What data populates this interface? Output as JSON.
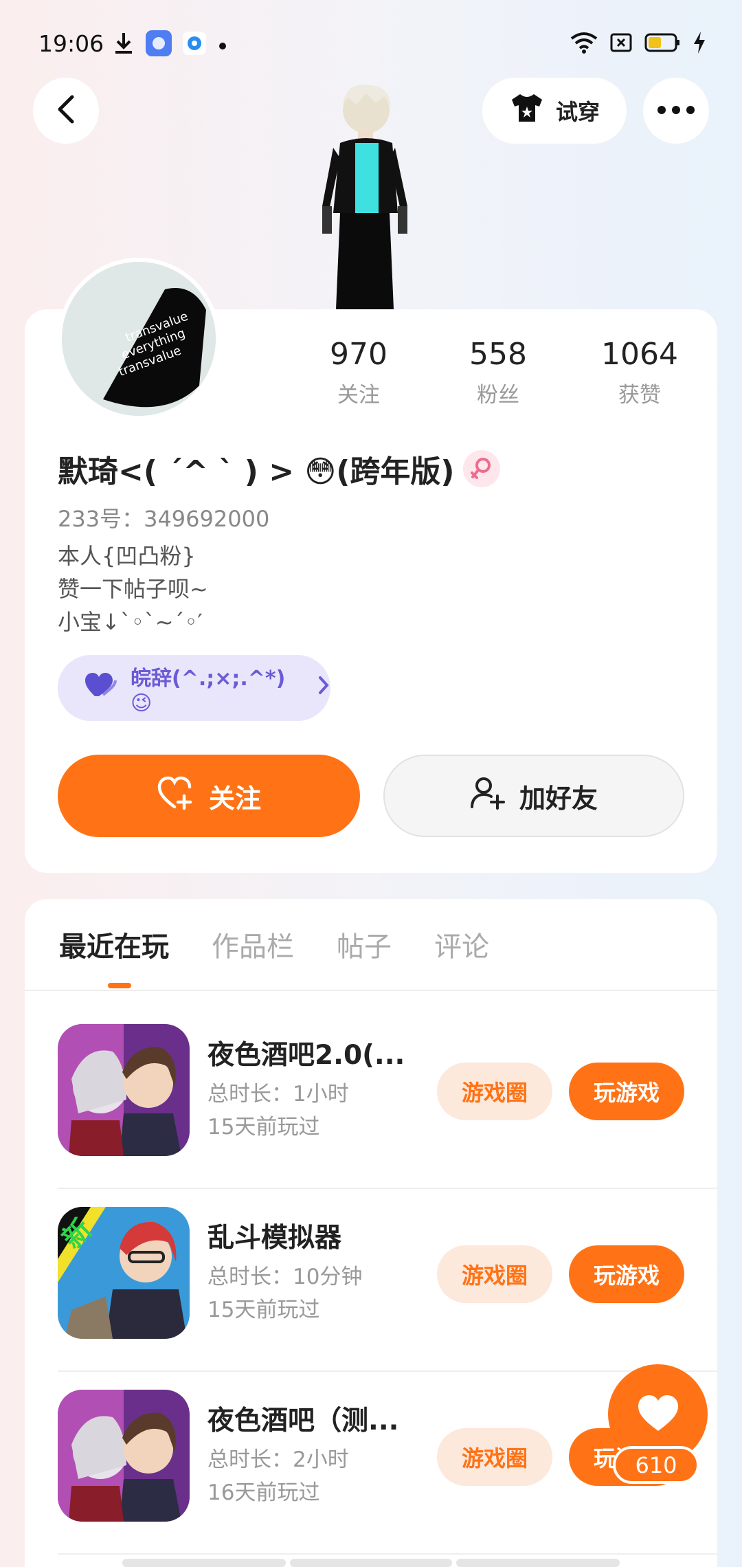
{
  "status_bar": {
    "time": "19:06",
    "icons": [
      "download-icon",
      "app-notification-icon",
      "app-notification-icon",
      "dot-icon",
      "wifi-icon",
      "sim-icon",
      "battery-icon",
      "charging-icon"
    ]
  },
  "header": {
    "try_on_label": "试穿"
  },
  "profile": {
    "stats": [
      {
        "value": "970",
        "label": "关注"
      },
      {
        "value": "558",
        "label": "粉丝"
      },
      {
        "value": "1064",
        "label": "获赞"
      }
    ],
    "nickname": "默琦<( ´^ ` ) > 😳(跨年版)",
    "uid": "233号：349692000",
    "bio_lines": [
      "本人{凹凸粉}",
      "赞一下帖子呗~",
      "小宝↓`◦`~´◦′"
    ],
    "tag_label": "皖辞(^.;×;.^*)😉",
    "follow_label": "关注",
    "add_friend_label": "加好友"
  },
  "tabs": [
    {
      "label": "最近在玩",
      "active": true
    },
    {
      "label": "作品栏",
      "active": false
    },
    {
      "label": "帖子",
      "active": false
    },
    {
      "label": "评论",
      "active": false
    }
  ],
  "games": [
    {
      "title": "夜色酒吧2.0(...",
      "duration": "总时长：1小时",
      "last_played": "15天前玩过",
      "circle_label": "游戏圈",
      "play_label": "玩游戏"
    },
    {
      "title": "乱斗模拟器",
      "duration": "总时长：10分钟",
      "last_played": "15天前玩过",
      "circle_label": "游戏圈",
      "play_label": "玩游戏",
      "badge": "新"
    },
    {
      "title": "夜色酒吧（测...",
      "duration": "总时长：2小时",
      "last_played": "16天前玩过",
      "circle_label": "游戏圈",
      "play_label": "玩游戏"
    }
  ],
  "fab": {
    "count": "610"
  },
  "colors": {
    "accent": "#ff7316",
    "tag_bg": "#e9e6fb",
    "tag_text": "#6a5bd6"
  }
}
